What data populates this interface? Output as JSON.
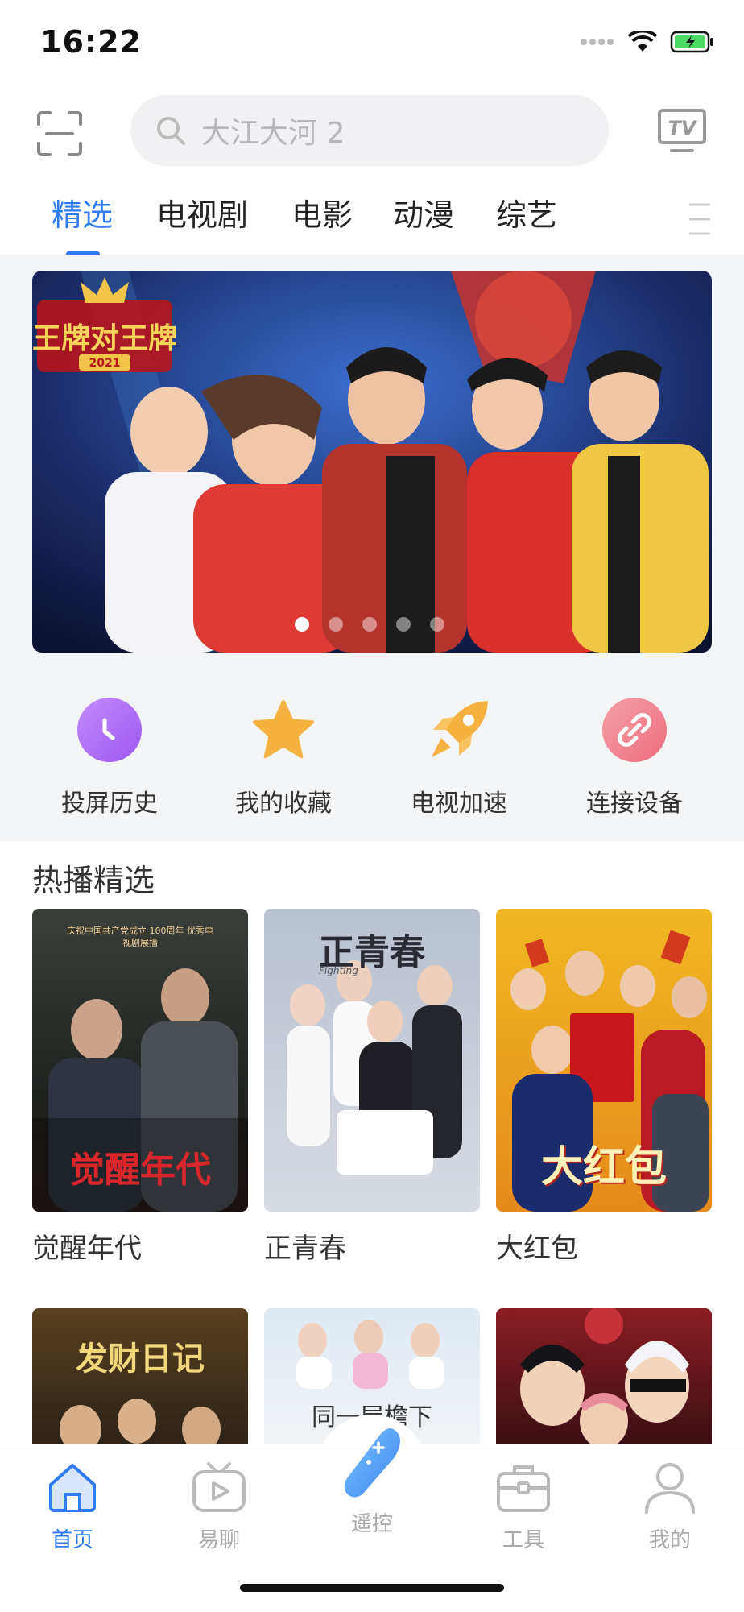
{
  "status_bar": {
    "time": "16:22"
  },
  "search": {
    "placeholder": "大江大河 2"
  },
  "tabs": [
    {
      "label": "精选",
      "active": true
    },
    {
      "label": "电视剧",
      "active": false
    },
    {
      "label": "电影",
      "active": false
    },
    {
      "label": "动漫",
      "active": false
    },
    {
      "label": "综艺",
      "active": false
    }
  ],
  "banner": {
    "logo_text": "王牌对王牌",
    "logo_year": "2021",
    "slide_count": 5,
    "active_slide": 1
  },
  "quick_actions": [
    {
      "label": "投屏历史",
      "icon": "clock-icon",
      "color": "#a76cf2"
    },
    {
      "label": "我的收藏",
      "icon": "star-icon",
      "color": "#f6b23f"
    },
    {
      "label": "电视加速",
      "icon": "rocket-icon",
      "color": "#f6b23f"
    },
    {
      "label": "连接设备",
      "icon": "link-icon",
      "color": "#f07f8a"
    }
  ],
  "hot_section": {
    "title": "热播精选",
    "items": [
      {
        "title": "觉醒年代",
        "poster_text": "觉醒年代",
        "poster_sub": "庆祝中国共产党成立 100周年 优秀电视剧展播"
      },
      {
        "title": "正青春",
        "poster_text": "正青春",
        "poster_sub": "Fighting"
      },
      {
        "title": "大红包",
        "poster_text": "大红包",
        "poster_sub": ""
      }
    ],
    "row2": [
      {
        "poster_text": "发财日记"
      },
      {
        "poster_text": "同一屋檐下"
      },
      {
        "poster_text": ""
      }
    ]
  },
  "bottom_nav": [
    {
      "label": "首页",
      "icon": "home-icon",
      "active": true
    },
    {
      "label": "易聊",
      "icon": "tv-play-icon",
      "active": false
    },
    {
      "label": "遥控",
      "icon": "remote-icon",
      "active": false
    },
    {
      "label": "工具",
      "icon": "toolbox-icon",
      "active": false
    },
    {
      "label": "我的",
      "icon": "user-icon",
      "active": false
    }
  ],
  "colors": {
    "accent": "#2f7bf3",
    "section_bg": "#f4f5f7"
  }
}
